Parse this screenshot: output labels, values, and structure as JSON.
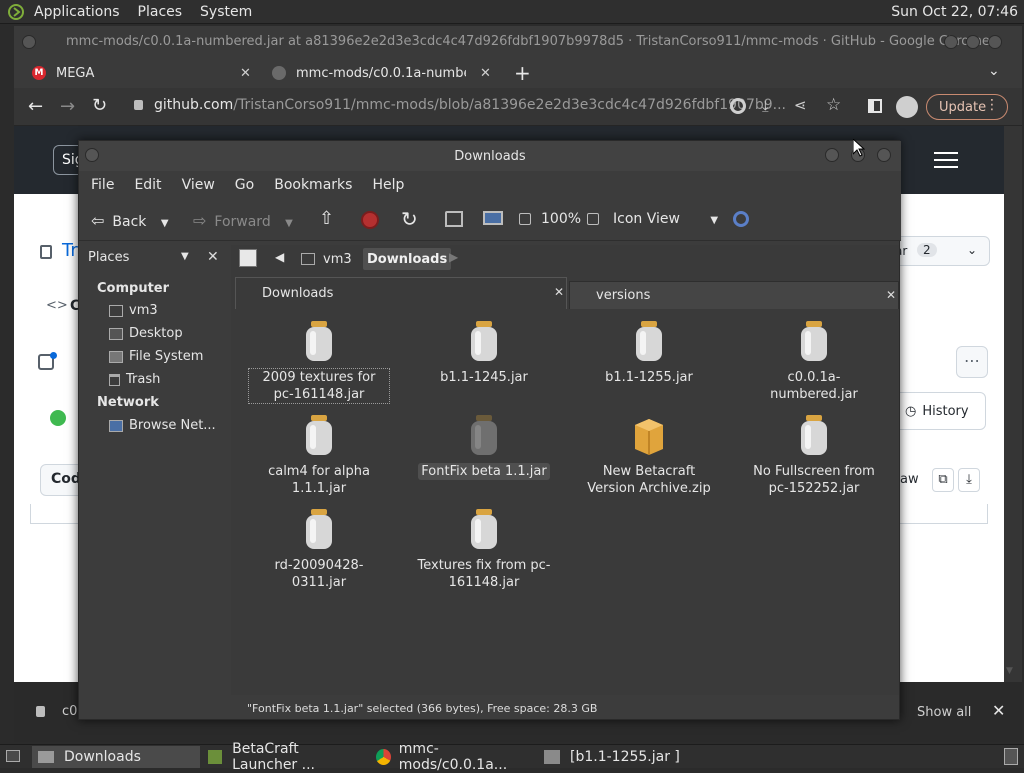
{
  "top_panel": {
    "menus": [
      "Applications",
      "Places",
      "System"
    ],
    "clock": "Sun Oct 22, 07:46"
  },
  "chrome": {
    "window_title": "mmc-mods/c0.0.1a-numbered.jar at a81396e2e2d3e3cdc4c47d926fdbf1907b9978d5 · TristanCorso911/mmc-mods · GitHub - Google Chrome",
    "tabs": [
      {
        "label": "MEGA",
        "icon": "mega-icon"
      },
      {
        "label": "mmc-mods/c0.0.1a-numbere",
        "icon": "github-icon"
      }
    ],
    "url_host": "github.com",
    "url_path": "/TristanCorso911/mmc-mods/blob/a81396e2e2d3e3cdc4c47d926fdbf1907b9...",
    "update_label": "Update",
    "downloads_bar": {
      "item": "c0",
      "show_all": "Show all"
    },
    "page_fragments": {
      "sign_in": "Sig",
      "repo_initial": "Tr",
      "code_tab": "C",
      "code_button": "Cod",
      "history": "History",
      "star_label": "ar",
      "star_count": "2",
      "raw": "aw"
    }
  },
  "file_manager": {
    "title": "Downloads",
    "menu": [
      "File",
      "Edit",
      "View",
      "Go",
      "Bookmarks",
      "Help"
    ],
    "toolbar": {
      "back": "Back",
      "forward": "Forward",
      "zoom": "100%",
      "view_mode": "Icon View"
    },
    "sidebar": {
      "header": "Places",
      "sections": [
        {
          "title": "Computer",
          "items": [
            "vm3",
            "Desktop",
            "File System",
            "Trash"
          ]
        },
        {
          "title": "Network",
          "items": [
            "Browse Net..."
          ]
        }
      ]
    },
    "path": [
      "vm3",
      "Downloads"
    ],
    "tabs": [
      "Downloads",
      "versions"
    ],
    "files": [
      {
        "name": "2009 textures for pc-161148.jar",
        "type": "jar"
      },
      {
        "name": "b1.1-1245.jar",
        "type": "jar"
      },
      {
        "name": "b1.1-1255.jar",
        "type": "jar"
      },
      {
        "name": "c0.0.1a-numbered.jar",
        "type": "jar"
      },
      {
        "name": "calm4 for alpha 1.1.1.jar",
        "type": "jar"
      },
      {
        "name": "FontFix beta 1.1.jar",
        "type": "jar-selected"
      },
      {
        "name": "New Betacraft Version Archive.zip",
        "type": "zip"
      },
      {
        "name": "No Fullscreen from pc-152252.jar",
        "type": "jar"
      },
      {
        "name": "rd-20090428-0311.jar",
        "type": "jar"
      },
      {
        "name": "Textures fix from pc-161148.jar",
        "type": "jar"
      }
    ],
    "status": "\"FontFix beta 1.1.jar\" selected (366 bytes), Free space: 28.3 GB"
  },
  "taskbar": {
    "tasks": [
      "Downloads",
      "BetaCraft Launcher ...",
      "mmc-mods/c0.0.1a...",
      "[b1.1-1255.jar ]"
    ]
  }
}
